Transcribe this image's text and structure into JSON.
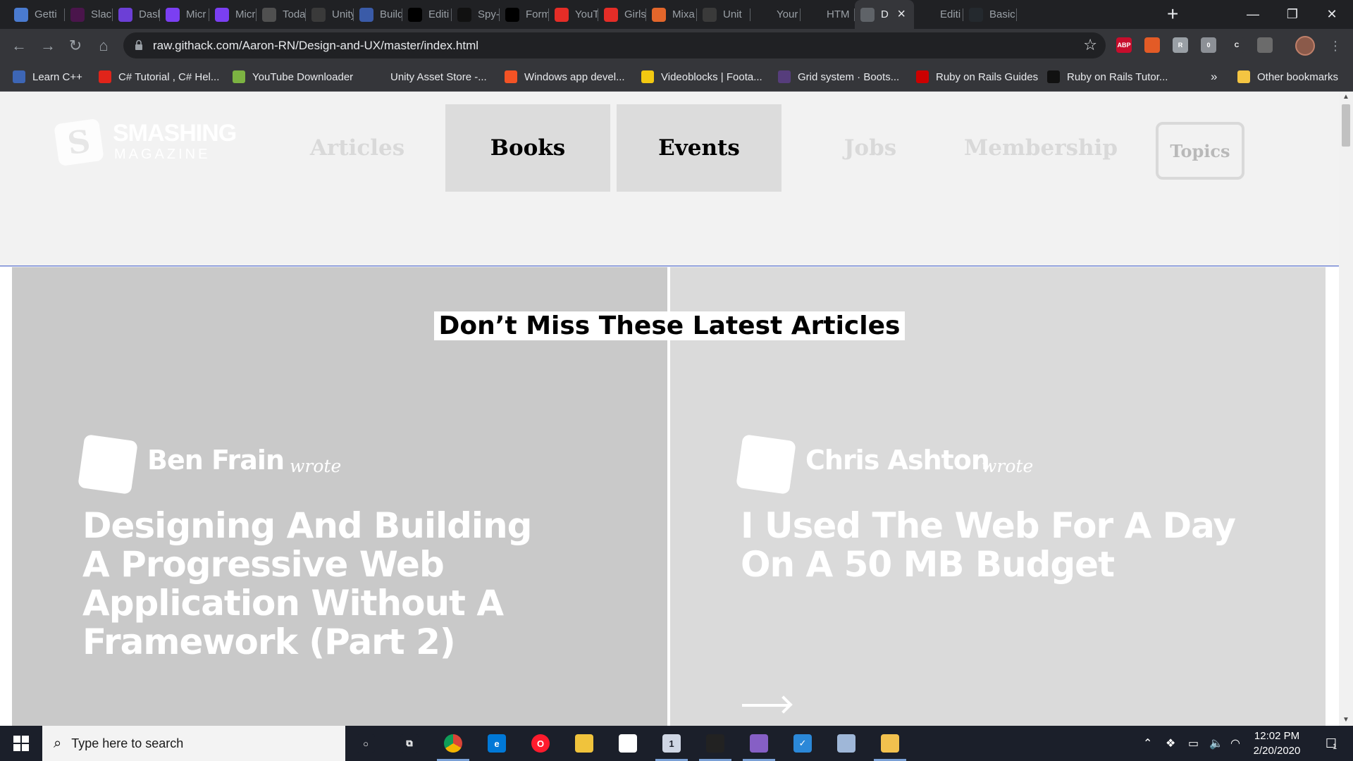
{
  "tabs": [
    {
      "title": "Getti",
      "icon": "hexagon-icon",
      "color": "#4a7bd0"
    },
    {
      "title": "Slack",
      "icon": "slack-icon",
      "color": "#4a154b"
    },
    {
      "title": "Dash",
      "icon": "dashboard-icon",
      "color": "#6c3fd6"
    },
    {
      "title": "Micr",
      "icon": "m-icon",
      "color": "#7b3ff2"
    },
    {
      "title": "Micr",
      "icon": "m-icon",
      "color": "#7b3ff2"
    },
    {
      "title": "Toda",
      "icon": "peace-hand-icon",
      "color": "#505050"
    },
    {
      "title": "Unity",
      "icon": "unity-icon",
      "color": "#3a3a3a"
    },
    {
      "title": "Build",
      "icon": "cube-icon",
      "color": "#3a5ba8"
    },
    {
      "title": "Editi",
      "icon": "medium-m-icon",
      "color": "#000000"
    },
    {
      "title": "Spy-",
      "icon": "spy-icon",
      "color": "#111111"
    },
    {
      "title": "Form",
      "icon": "medium-m-icon",
      "color": "#000000"
    },
    {
      "title": "YouT",
      "icon": "youtube-icon",
      "color": "#e52d27"
    },
    {
      "title": "Girls",
      "icon": "youtube-icon",
      "color": "#e52d27"
    },
    {
      "title": "Mixa",
      "icon": "runner-icon",
      "color": "#e2662b"
    },
    {
      "title": "Unit",
      "icon": "unity-icon",
      "color": "#3a3a3a"
    },
    {
      "title": "Your",
      "icon": "",
      "color": ""
    },
    {
      "title": "HTM",
      "icon": "",
      "color": ""
    },
    {
      "title": "D",
      "icon": "globe-icon",
      "color": "#5f6368",
      "active": true
    },
    {
      "title": "Editi",
      "icon": "",
      "color": ""
    },
    {
      "title": "Basic",
      "icon": "github-icon",
      "color": "#24292e"
    }
  ],
  "toolbar": {
    "url": "raw.githack.com/Aaron-RN/Design-and-UX/master/index.html"
  },
  "extensions": [
    {
      "label": "ABP",
      "color": "#c70d2c",
      "icon": "adblock-icon"
    },
    {
      "label": "",
      "color": "#e35b26",
      "icon": "office-icon"
    },
    {
      "label": "R",
      "color": "#9aa0a6",
      "icon": "r-extension-icon"
    },
    {
      "label": "0",
      "color": "#8c9096",
      "icon": "shield-badge-icon"
    },
    {
      "label": "C",
      "color": "#35363a",
      "icon": "c-extension-icon"
    },
    {
      "label": "",
      "color": "#6b6b6b",
      "icon": "bottle-icon"
    }
  ],
  "bookmarks": [
    {
      "label": "Learn C++",
      "icon": "cpp-icon",
      "color": "#3d66b5"
    },
    {
      "label": "C# Tutorial , C# Hel...",
      "icon": "n-icon",
      "color": "#e0241a"
    },
    {
      "label": "YouTube Downloader",
      "icon": "download-arrow-icon",
      "color": "#7cb342"
    },
    {
      "label": "Unity Asset Store -...",
      "icon": "unity-icon",
      "color": "#35363a"
    },
    {
      "label": "Windows app devel...",
      "icon": "windows-logo-icon",
      "color": "#f35325"
    },
    {
      "label": "Videoblocks | Foota...",
      "icon": "dollar-icon",
      "color": "#f2c811"
    },
    {
      "label": "Grid system · Boots...",
      "icon": "bootstrap-icon",
      "color": "#563d7c"
    },
    {
      "label": "Ruby on Rails Guides",
      "icon": "rails-icon",
      "color": "#cc0000"
    },
    {
      "label": "Ruby on Rails Tutor...",
      "icon": "rails-dark-icon",
      "color": "#111111"
    }
  ],
  "bookmarks_overflow": "»",
  "other_bookmarks": "Other bookmarks",
  "site": {
    "logo_title": "SMASHING",
    "logo_sub": "MAGAZINE",
    "nav": [
      "Articles",
      "Books",
      "Events",
      "Jobs",
      "Membership"
    ],
    "nav_active": [
      "Books",
      "Events"
    ],
    "topics": "Topics",
    "section_title": "Don’t Miss These Latest Articles",
    "articles": [
      {
        "author": "Ben Frain",
        "wrote": "wrote",
        "title": "Designing And Building A Progressive Web Application Without A Framework (Part 2)"
      },
      {
        "author": "Chris Ashton",
        "wrote": "wrote",
        "title": "I Used The Web For A Day On A 50 MB Budget"
      }
    ]
  },
  "taskbar": {
    "search_placeholder": "Type here to search",
    "apps": [
      {
        "name": "cortana-icon",
        "color": "#1b1f2a",
        "label": "○",
        "running": false
      },
      {
        "name": "task-view-icon",
        "color": "#1b1f2a",
        "label": "⧉",
        "running": false
      },
      {
        "name": "chrome-icon",
        "color": "#4285f4",
        "label": "",
        "running": true
      },
      {
        "name": "edge-icon",
        "color": "#0078d7",
        "label": "e",
        "running": false
      },
      {
        "name": "opera-icon",
        "color": "#ff1b2d",
        "label": "O",
        "running": false
      },
      {
        "name": "file-explorer-icon",
        "color": "#f0c33c",
        "label": "",
        "running": false
      },
      {
        "name": "store-icon",
        "color": "#ffffff",
        "label": "",
        "running": false
      },
      {
        "name": "mail-icon",
        "color": "#cfd6e4",
        "label": "1",
        "running": true
      },
      {
        "name": "unity-hub-icon",
        "color": "#222222",
        "label": "",
        "running": true
      },
      {
        "name": "visual-studio-icon",
        "color": "#865fc5",
        "label": "",
        "running": true
      },
      {
        "name": "todo-icon",
        "color": "#2b88d8",
        "label": "✓",
        "running": false
      },
      {
        "name": "box-3d-icon",
        "color": "#9fb7d8",
        "label": "",
        "running": false
      },
      {
        "name": "notes-icon",
        "color": "#f2c14e",
        "label": "",
        "running": true
      }
    ],
    "time": "12:02 PM",
    "date": "2/20/2020",
    "notifications": "1"
  }
}
